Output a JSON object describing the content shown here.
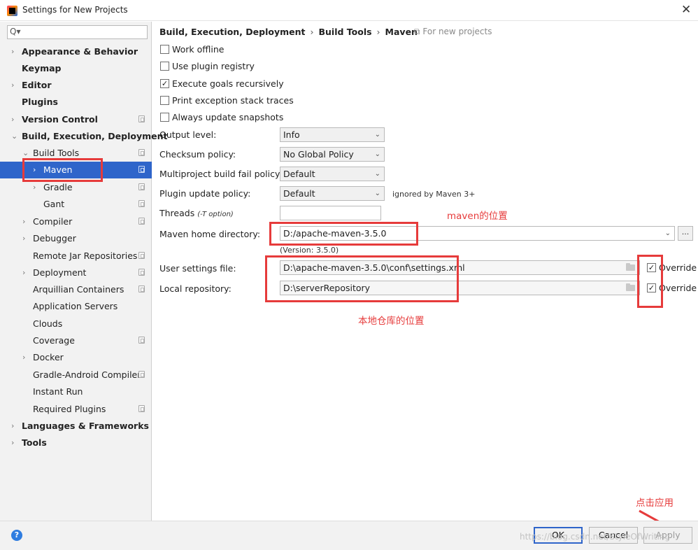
{
  "window": {
    "title": "Settings for New Projects",
    "close_glyph": "✕"
  },
  "search": {
    "icon": "Q▾",
    "value": ""
  },
  "sidebar": {
    "items": [
      {
        "label": "Appearance & Behavior",
        "arrow": "›"
      },
      {
        "label": "Keymap",
        "arrow": ""
      },
      {
        "label": "Editor",
        "arrow": "›"
      },
      {
        "label": "Plugins",
        "arrow": ""
      },
      {
        "label": "Version Control",
        "arrow": "›"
      },
      {
        "label": "Build, Execution, Deployment",
        "arrow": "⌄"
      },
      {
        "label": "Build Tools",
        "arrow": "⌄"
      },
      {
        "label": "Maven",
        "arrow": "›"
      },
      {
        "label": "Gradle",
        "arrow": "›"
      },
      {
        "label": "Gant",
        "arrow": ""
      },
      {
        "label": "Compiler",
        "arrow": "›"
      },
      {
        "label": "Debugger",
        "arrow": "›"
      },
      {
        "label": "Remote Jar Repositories",
        "arrow": ""
      },
      {
        "label": "Deployment",
        "arrow": "›"
      },
      {
        "label": "Arquillian Containers",
        "arrow": ""
      },
      {
        "label": "Application Servers",
        "arrow": ""
      },
      {
        "label": "Clouds",
        "arrow": ""
      },
      {
        "label": "Coverage",
        "arrow": ""
      },
      {
        "label": "Docker",
        "arrow": "›"
      },
      {
        "label": "Gradle-Android Compiler",
        "arrow": ""
      },
      {
        "label": "Instant Run",
        "arrow": ""
      },
      {
        "label": "Required Plugins",
        "arrow": ""
      },
      {
        "label": "Languages & Frameworks",
        "arrow": "›"
      },
      {
        "label": "Tools",
        "arrow": "›"
      }
    ]
  },
  "breadcrumb": {
    "part1": "Build, Execution, Deployment",
    "part2": "Build Tools",
    "part3": "Maven",
    "sep": "›",
    "scope": "⧉ For new projects"
  },
  "checkboxes": [
    {
      "label": "Work offline",
      "checked": false,
      "mark": ""
    },
    {
      "label": "Use plugin registry",
      "checked": false,
      "mark": ""
    },
    {
      "label": "Execute goals recursively",
      "checked": true,
      "mark": "✓"
    },
    {
      "label": "Print exception stack traces",
      "checked": false,
      "mark": ""
    },
    {
      "label": "Always update snapshots",
      "checked": false,
      "mark": ""
    }
  ],
  "form": {
    "output_level": {
      "label": "Output level:",
      "value": "Info"
    },
    "checksum_policy": {
      "label": "Checksum policy:",
      "value": "No Global Policy"
    },
    "multiproject_fail": {
      "label": "Multiproject build fail policy:",
      "value": "Default"
    },
    "plugin_update": {
      "label": "Plugin update policy:",
      "value": "Default",
      "note": "ignored by Maven 3+"
    },
    "threads": {
      "label": "Threads",
      "hint": "(-T option)",
      "value": ""
    },
    "maven_home": {
      "label": "Maven home directory:",
      "value": "D:/apache-maven-3.5.0",
      "version": "(Version: 3.5.0)",
      "browse": "..."
    },
    "user_settings": {
      "label": "User settings file:",
      "value": "D:\\apache-maven-3.5.0\\conf\\settings.xml",
      "override_label": "Override",
      "override_checked": true,
      "mark": "✓"
    },
    "local_repo": {
      "label": "Local repository:",
      "value": "D:\\serverRepository",
      "override_label": "Override",
      "override_checked": true,
      "mark": "✓"
    },
    "dropdown_glyph": "⌄"
  },
  "annotations": {
    "maven_location": "maven的位置",
    "local_repo_location": "本地仓库的位置",
    "click_apply": "点击应用",
    "color": "#e63b3b"
  },
  "footer": {
    "help": "?",
    "ok": "OK",
    "cancel": "Cancel",
    "apply": "Apply",
    "watermark": "https://blog.csdn.net/StyleOfWriting"
  }
}
